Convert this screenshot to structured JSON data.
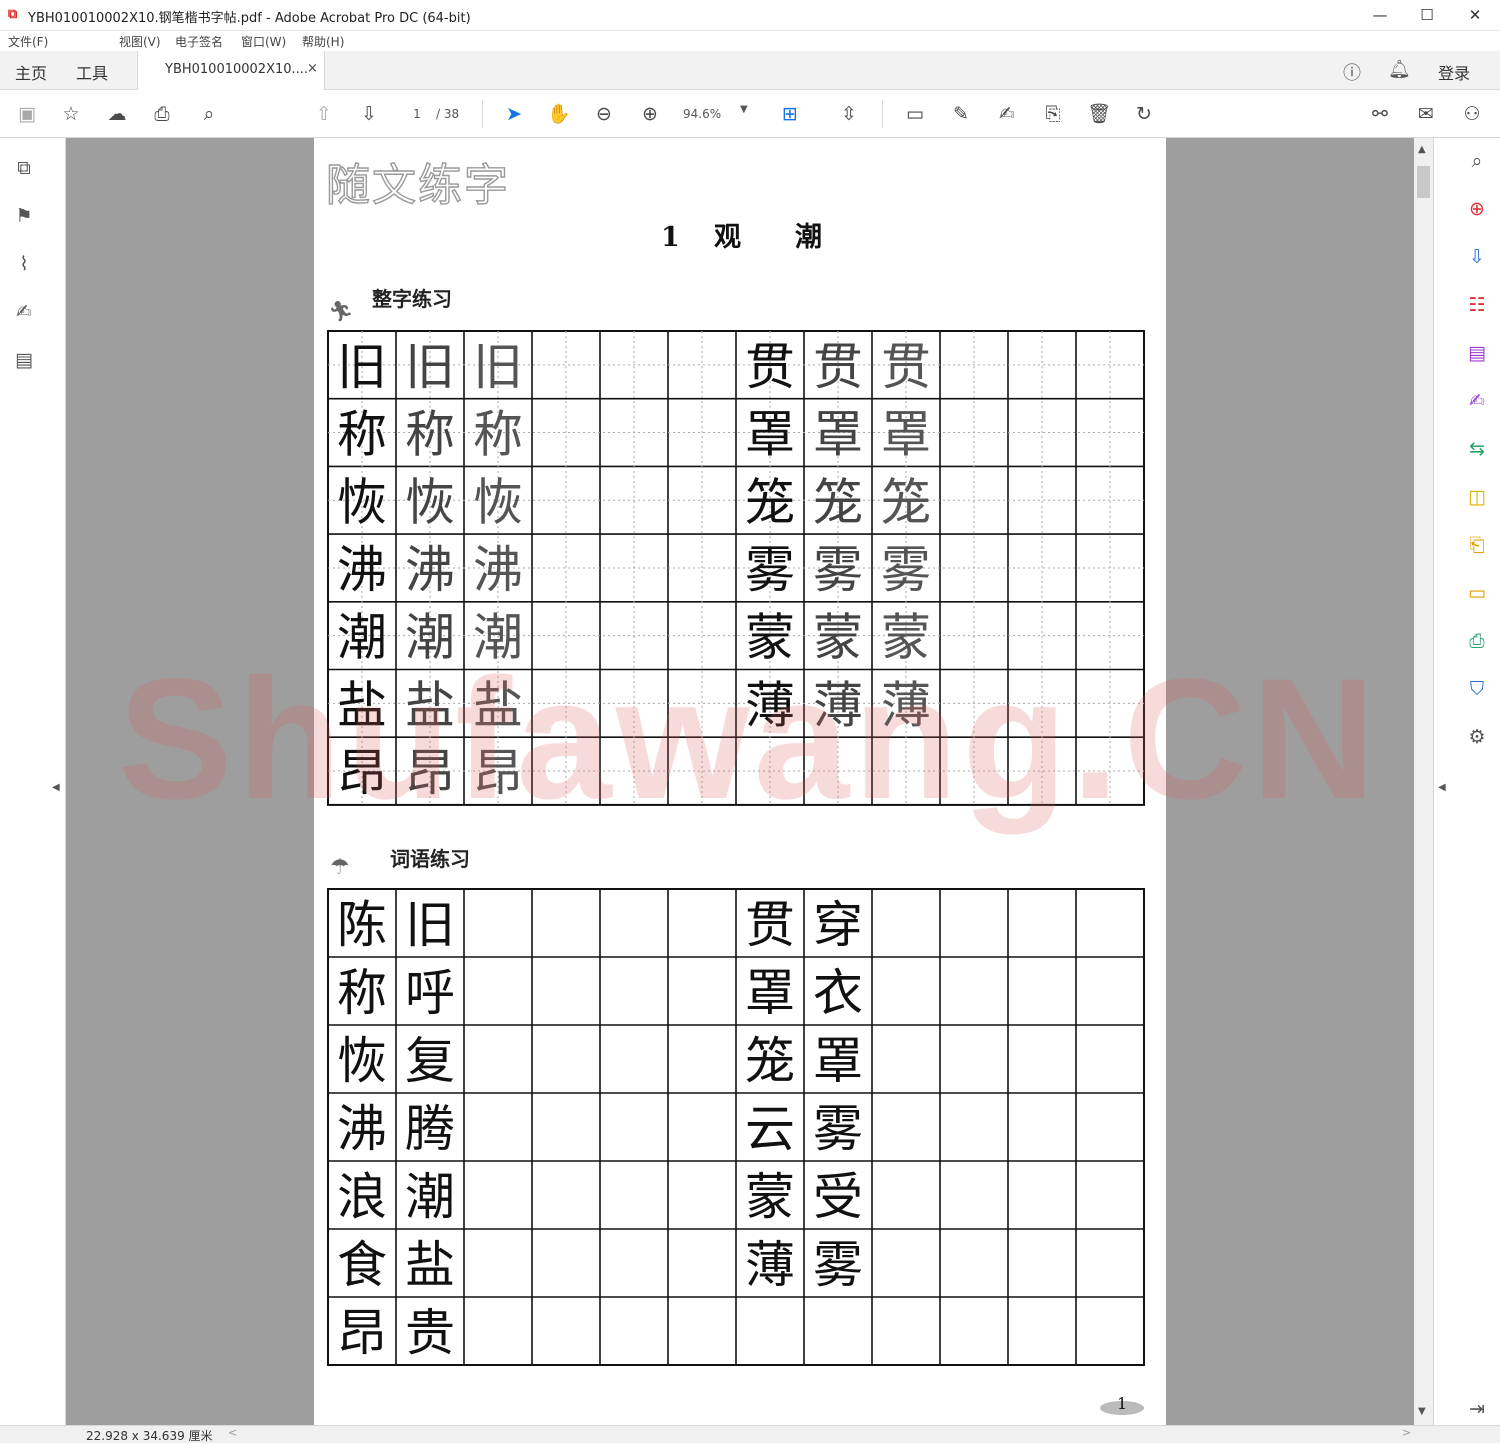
{
  "window": {
    "title": "YBH010010002X10.钢笔楷书字帖.pdf - Adobe Acrobat Pro DC (64-bit)",
    "minimize": "—",
    "maximize": "☐",
    "close": "✕"
  },
  "menu": [
    "文件(F)",
    "视图(V)",
    "电子签名",
    "窗口(W)",
    "帮助(H)"
  ],
  "tabs": {
    "home": "主页",
    "tools": "工具",
    "document": "YBH010010002X10....",
    "close": "×",
    "login": "登录"
  },
  "toolbar": {
    "page_current": "1",
    "page_total": "/ 38",
    "zoom": "94.6%"
  },
  "document": {
    "header_logo": "随文练字",
    "lesson_number": "1",
    "lesson_title": "观　　潮",
    "section1_title": "整字练习",
    "section2_title": "词语练习",
    "page_number": "1",
    "char_practice": {
      "left": [
        "旧",
        "称",
        "恢",
        "沸",
        "潮",
        "盐",
        "昂"
      ],
      "right": [
        "贯",
        "罩",
        "笼",
        "雾",
        "蒙",
        "薄"
      ]
    },
    "word_practice": {
      "left": [
        [
          "陈",
          "旧"
        ],
        [
          "称",
          "呼"
        ],
        [
          "恢",
          "复"
        ],
        [
          "沸",
          "腾"
        ],
        [
          "浪",
          "潮"
        ],
        [
          "食",
          "盐"
        ],
        [
          "昂",
          "贵"
        ]
      ],
      "right": [
        [
          "贯",
          "穿"
        ],
        [
          "罩",
          "衣"
        ],
        [
          "笼",
          "罩"
        ],
        [
          "云",
          "雾"
        ],
        [
          "蒙",
          "受"
        ],
        [
          "薄",
          "雾"
        ]
      ]
    }
  },
  "watermark": "Shufawang.CN",
  "status": {
    "dimensions": "22.928 x 34.639 厘米"
  }
}
